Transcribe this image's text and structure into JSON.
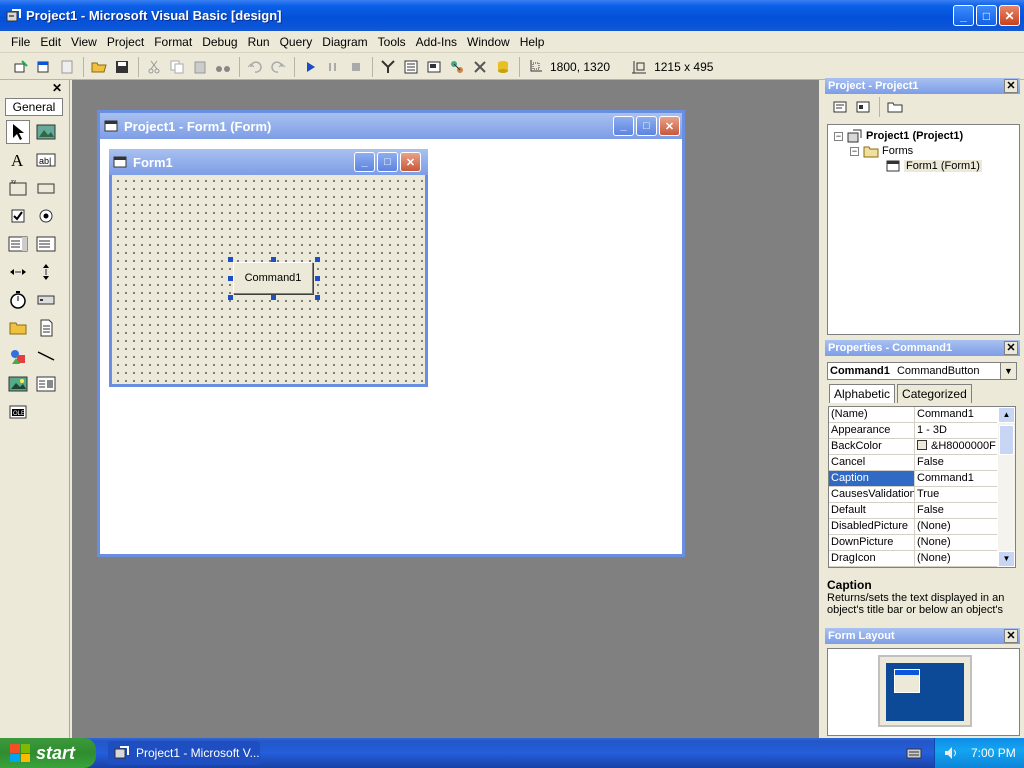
{
  "window": {
    "title": "Project1 - Microsoft Visual Basic [design]",
    "min": "_",
    "max": "□",
    "close": "✕"
  },
  "menu": [
    "File",
    "Edit",
    "View",
    "Project",
    "Format",
    "Debug",
    "Run",
    "Query",
    "Diagram",
    "Tools",
    "Add-Ins",
    "Window",
    "Help"
  ],
  "toolbar": {
    "position": "1800, 1320",
    "size": "1215 x 495"
  },
  "toolbox": {
    "tab": "General",
    "close": "✕"
  },
  "designer": {
    "title": "Project1 - Form1 (Form)",
    "form_title": "Form1",
    "button_caption": "Command1"
  },
  "project": {
    "title": "Project - Project1",
    "close": "✕",
    "root": "Project1 (Project1)",
    "folder": "Forms",
    "item": "Form1 (Form1)"
  },
  "properties": {
    "title": "Properties - Command1",
    "close": "✕",
    "object": "Command1",
    "object_type": "CommandButton",
    "tabs": [
      "Alphabetic",
      "Categorized"
    ],
    "rows": [
      {
        "name": "(Name)",
        "value": "Command1"
      },
      {
        "name": "Appearance",
        "value": "1 - 3D"
      },
      {
        "name": "BackColor",
        "value": "&H8000000F"
      },
      {
        "name": "Cancel",
        "value": "False"
      },
      {
        "name": "Caption",
        "value": "Command1"
      },
      {
        "name": "CausesValidation",
        "value": "True"
      },
      {
        "name": "Default",
        "value": "False"
      },
      {
        "name": "DisabledPicture",
        "value": "(None)"
      },
      {
        "name": "DownPicture",
        "value": "(None)"
      },
      {
        "name": "DragIcon",
        "value": "(None)"
      }
    ],
    "selected_row": "Caption",
    "desc_name": "Caption",
    "desc_text": "Returns/sets the text displayed in an object's title bar or below an object's"
  },
  "form_layout": {
    "title": "Form Layout",
    "close": "✕"
  },
  "taskbar": {
    "start": "start",
    "item": "Project1 - Microsoft V...",
    "clock": "7:00 PM"
  },
  "colors": {
    "accent": "#0a55d9",
    "selection": "#316ac5",
    "mdi_bg": "#808080"
  }
}
